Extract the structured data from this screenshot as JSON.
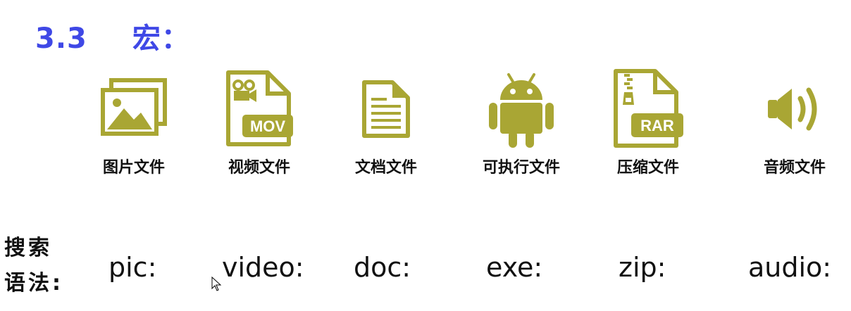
{
  "heading": {
    "number": "3.3",
    "title": "宏："
  },
  "icon_color": "#a9a634",
  "heading_color": "#3f48e6",
  "file_types": [
    {
      "label": "图片文件",
      "icon": "image-icon"
    },
    {
      "label": "视频文件",
      "icon": "video-file-icon",
      "badge": "MOV"
    },
    {
      "label": "文档文件",
      "icon": "document-icon"
    },
    {
      "label": "可执行文件",
      "icon": "android-icon"
    },
    {
      "label": "压缩文件",
      "icon": "archive-file-icon",
      "badge": "RAR"
    },
    {
      "label": "音频文件",
      "icon": "speaker-icon"
    }
  ],
  "syntax": {
    "label_line1": "搜索",
    "label_line2": "语法:",
    "keywords": [
      "pic:",
      "video:",
      "doc:",
      "exe:",
      "zip:",
      "audio:"
    ]
  }
}
